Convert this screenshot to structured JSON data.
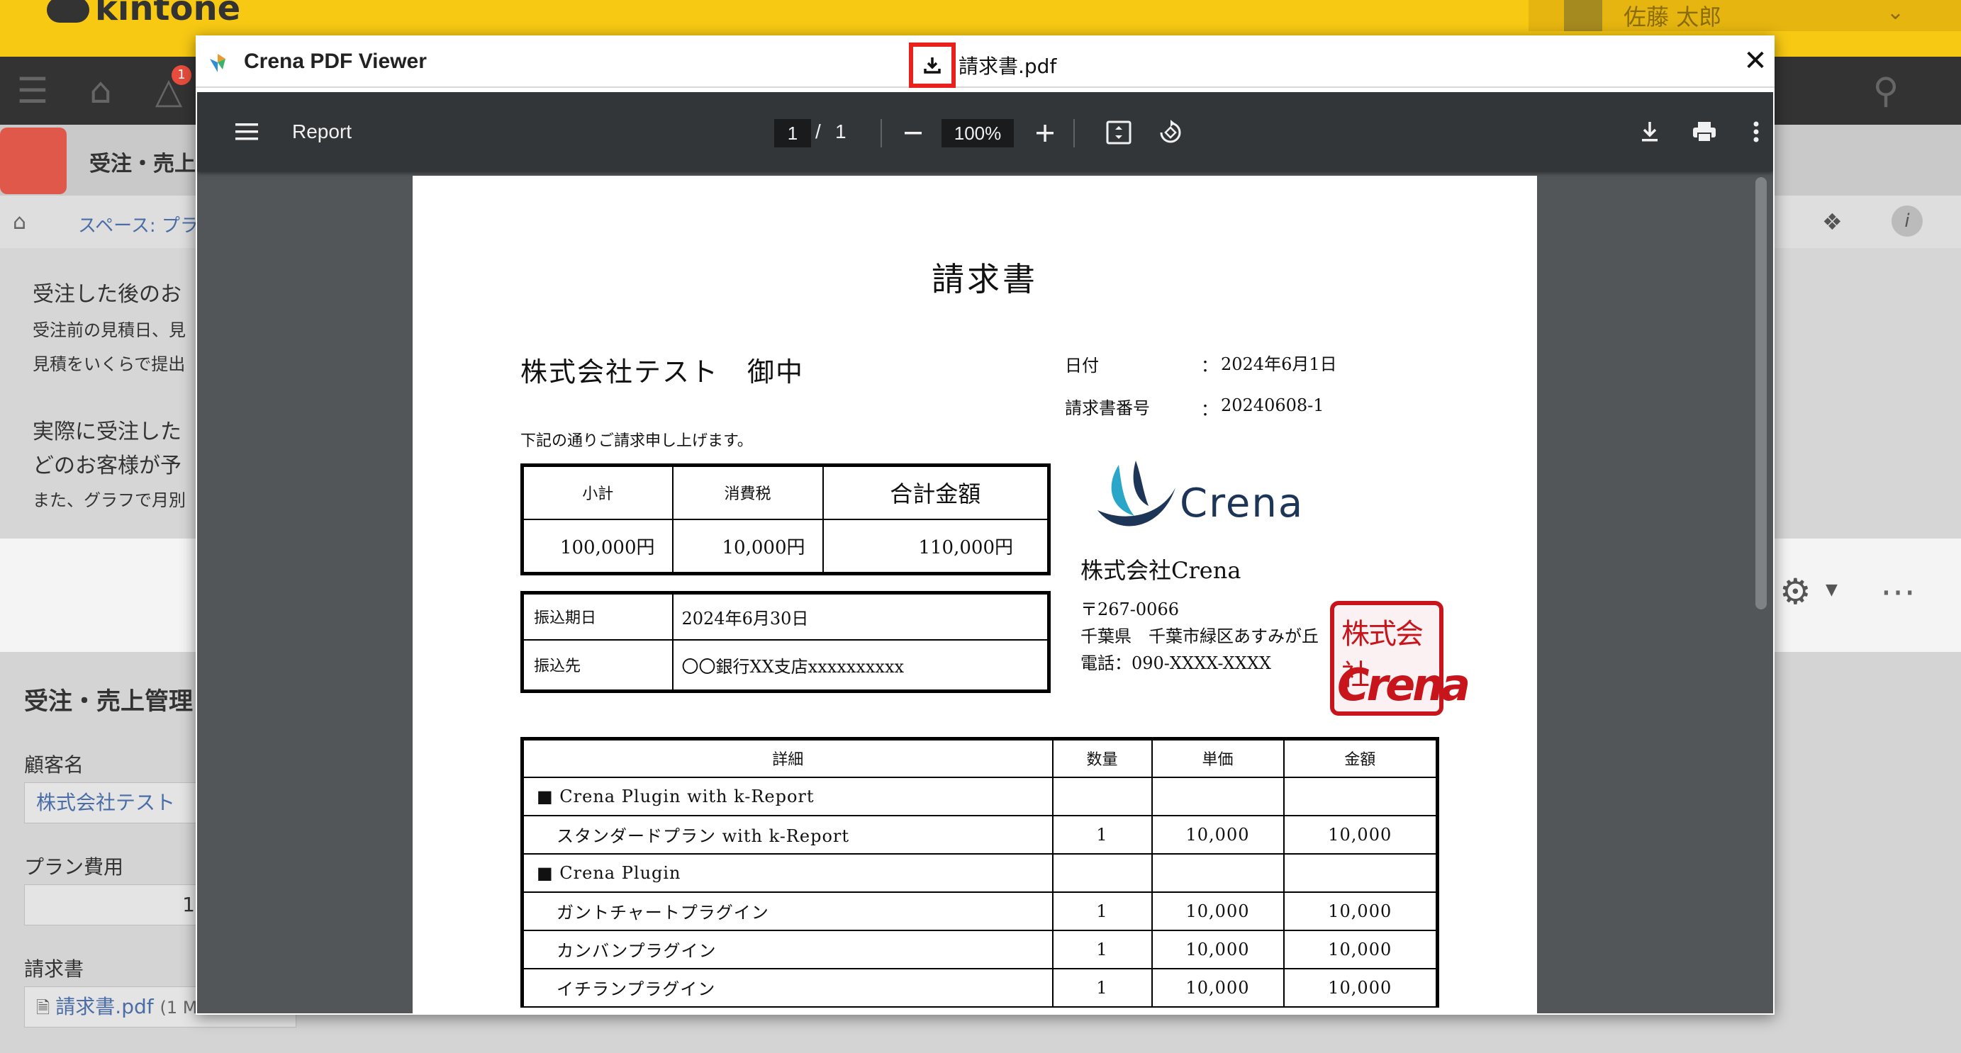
{
  "kintone": {
    "logo_text": "kintone",
    "user_name": "佐藤 太郎",
    "notification_count": "1",
    "app_title": "受注・売上",
    "breadcrumb": "スペース: プラ",
    "description": [
      "受注した後のお",
      "受注前の見積日、見",
      "見積をいくらで提出",
      "実際に受注した",
      "どのお客様が予",
      "また、グラフで月別"
    ],
    "form": {
      "title": "受注・売上管理",
      "customer_label": "顧客名",
      "customer_value": "株式会社テスト",
      "plan_label": "プラン費用",
      "plan_value": "1",
      "invoice_label": "請求書",
      "invoice_file": "請求書.pdf",
      "invoice_size": "(1 M"
    }
  },
  "dialog": {
    "title": "Crena PDF Viewer",
    "filename": "請求書.pdf",
    "accent_color": "#e8211c"
  },
  "viewer": {
    "doc_title": "Report",
    "current_page": "1",
    "page_separator": "/",
    "total_pages": "1",
    "zoom": "100%"
  },
  "invoice": {
    "title": "請求書",
    "client": "株式会社テスト　御中",
    "date_label": "日付",
    "date_value": "2024年6月1日",
    "number_label": "請求書番号",
    "number_value": "20240608-1",
    "colon": "：",
    "intro": "下記の通りご請求申し上げます。",
    "summary": {
      "headers": [
        "小計",
        "消費税",
        "合計金額"
      ],
      "values": [
        "100,000円",
        "10,000円",
        "110,000円"
      ]
    },
    "payment": {
      "due_label": "振込期日",
      "due_value": "2024年6月30日",
      "bank_label": "振込先",
      "bank_value": "〇〇銀行XX支店xxxxxxxxxx"
    },
    "company": {
      "logo_text": "Crena",
      "name": "株式会社Crena",
      "postal": "〒267-0066",
      "address": "千葉県　千葉市緑区あすみが丘",
      "phone": "電話：090-XXXX-XXXX",
      "stamp_top": "株式会社",
      "stamp_bottom": "Crena"
    },
    "items_headers": [
      "詳細",
      "数量",
      "単価",
      "金額"
    ],
    "items": [
      {
        "detail": "■ Crena Plugin with k-Report",
        "qty": "",
        "unit": "",
        "amount": "",
        "group": true
      },
      {
        "detail": "スタンダードプラン with k-Report",
        "qty": "1",
        "unit": "10,000",
        "amount": "10,000",
        "group": false
      },
      {
        "detail": "■ Crena Plugin",
        "qty": "",
        "unit": "",
        "amount": "",
        "group": true
      },
      {
        "detail": "ガントチャートプラグイン",
        "qty": "1",
        "unit": "10,000",
        "amount": "10,000",
        "group": false
      },
      {
        "detail": "カンバンプラグイン",
        "qty": "1",
        "unit": "10,000",
        "amount": "10,000",
        "group": false
      },
      {
        "detail": "イチランプラグイン",
        "qty": "1",
        "unit": "10,000",
        "amount": "10,000",
        "group": false
      }
    ]
  }
}
